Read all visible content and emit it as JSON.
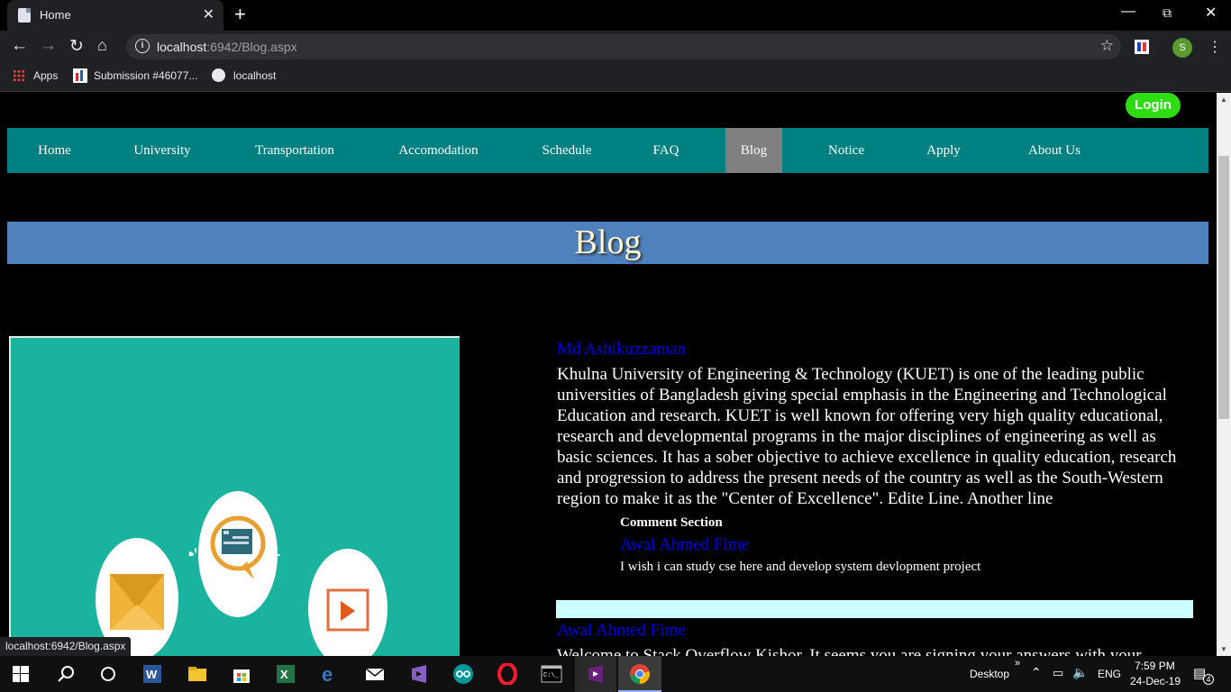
{
  "browser": {
    "tab_title": "Home",
    "tab_close": "✕",
    "new_tab": "+",
    "url_host": "localhost",
    "url_path": ":6942/Blog.aspx",
    "profile_initial": "S",
    "bookmarks": [
      "Apps",
      "Submission #46077...",
      "localhost"
    ],
    "status_url": "localhost:6942/Blog.aspx"
  },
  "page": {
    "login_label": "Login",
    "nav": [
      {
        "label": "Home"
      },
      {
        "label": "University"
      },
      {
        "label": "Transportation"
      },
      {
        "label": "Accomodation"
      },
      {
        "label": "Schedule"
      },
      {
        "label": "FAQ"
      },
      {
        "label": "Blog",
        "active": true
      },
      {
        "label": "Notice"
      },
      {
        "label": "Apply"
      },
      {
        "label": "About Us"
      }
    ],
    "banner_title": "Blog",
    "post": {
      "author": "Md Ashikuzzaman",
      "body": "Khulna University of Engineering & Technology (KUET) is one of the leading public universities of Bangladesh giving special emphasis in the Engineering and Technological Education and research. KUET is well known for offering very high quality educational, research and developmental programs in the major disciplines of engineering as well as basic sciences. It has a sober objective to achieve excellence in quality education, research and progression to address the present needs of the country as well as the South-Western region to make it as the \"Center of Excellence\". Edite Line. Another line",
      "comment_header": "Comment Section",
      "comment_author": "Awal Ahmed Fime",
      "comment_text": "I wish i can study cse here and develop system devlopment project"
    },
    "post2": {
      "author": "Awal Ahmed Fime",
      "body": "Welcome to Stack Overflow Kishor. It seems you are signing your answers with your"
    }
  },
  "taskbar": {
    "desktop_label": "Desktop",
    "lang": "ENG",
    "time": "7:59 PM",
    "date": "24-Dec-19",
    "notif_count": "4"
  },
  "colors": {
    "nav_bg": "#008080",
    "nav_active": "#808080",
    "banner_bg": "#4f81bd",
    "login_bg": "#2edc12",
    "link": "#0000ee",
    "separator": "#ccffff",
    "image_bg": "#1ab39e"
  }
}
